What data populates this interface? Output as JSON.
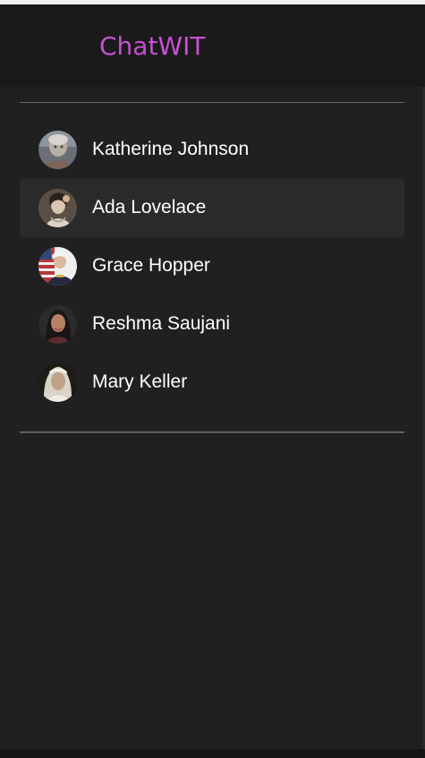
{
  "app": {
    "title": "ChatWIT",
    "colors": {
      "title": "#c94fd6",
      "background": "#202020",
      "header": "#1a1a1a",
      "active_row": "#2a2a2a",
      "text": "#ffffff"
    }
  },
  "contacts": [
    {
      "name": "Katherine Johnson",
      "avatar_icon": "katherine-johnson-avatar-icon",
      "active": false
    },
    {
      "name": "Ada Lovelace",
      "avatar_icon": "ada-lovelace-avatar-icon",
      "active": true
    },
    {
      "name": "Grace Hopper",
      "avatar_icon": "grace-hopper-avatar-icon",
      "active": false
    },
    {
      "name": "Reshma Saujani",
      "avatar_icon": "reshma-saujani-avatar-icon",
      "active": false
    },
    {
      "name": "Mary Keller",
      "avatar_icon": "mary-keller-avatar-icon",
      "active": false
    }
  ]
}
